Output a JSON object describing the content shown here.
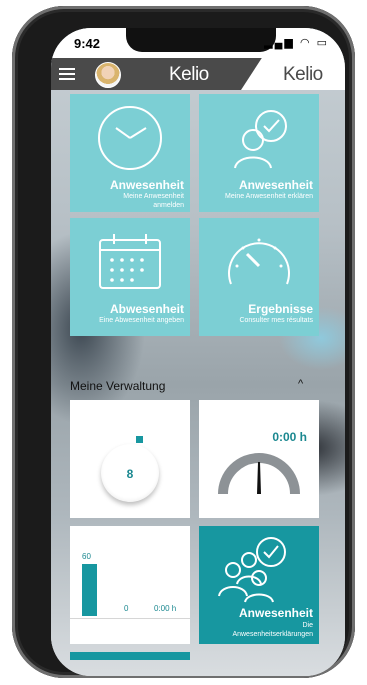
{
  "status_bar": {
    "time": "9:42"
  },
  "header": {
    "logo_left": "Kelio",
    "logo_right": "Kelio"
  },
  "tiles": [
    {
      "title": "Anwesenheit",
      "subtitle1": "Meine Anwesenheit",
      "subtitle2": "anmelden",
      "icon": "clock-icon"
    },
    {
      "title": "Anwesenheit",
      "subtitle1": "Meine Anwesenheit erklären",
      "icon": "person-check-icon"
    },
    {
      "title": "Abwesenheit",
      "subtitle1": "Eine Abwesenheit angeben",
      "icon": "calendar-icon"
    },
    {
      "title": "Ergebnisse",
      "subtitle1": "Consulter mes résultats",
      "icon": "gauge-icon"
    }
  ],
  "section": {
    "title": "Meine Verwaltung"
  },
  "widgets": {
    "counter_value": "8",
    "gauge_value": "0:00 h",
    "chart": {
      "bar_label": "60",
      "value_zero": "0",
      "hours": "0:00 h"
    },
    "teal_tile": {
      "title": "Anwesenheit",
      "subtitle1": "Die",
      "subtitle2": "Anwesenheitserklärungen",
      "icon": "people-check-icon"
    }
  },
  "colors": {
    "tile": "#7ccfd4",
    "teal": "#1797a0",
    "appbar": "#4a4a4a"
  }
}
